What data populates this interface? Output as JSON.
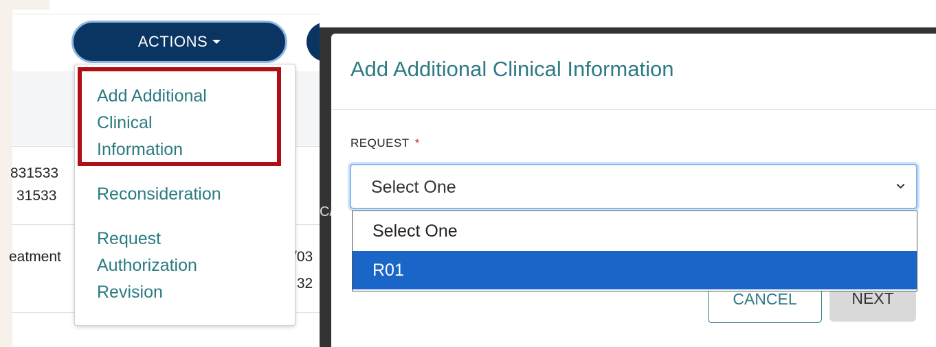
{
  "background_app": {
    "actions_button": {
      "label": "ACTIONS"
    },
    "actions_menu": {
      "items": [
        {
          "label_lines": [
            "Add Additional",
            "Clinical",
            "Information"
          ],
          "highlighted": true
        },
        {
          "label_lines": [
            "Reconsideration"
          ]
        },
        {
          "label_lines": [
            "Request",
            "Authorization",
            "Revision"
          ]
        }
      ]
    },
    "table_fragments": {
      "row1_line1": "831533",
      "row1_line2": "31533",
      "row2_line1": "eatment",
      "date_fragment": "/03",
      "time_fragment": ":32",
      "header_fragment": "C/"
    }
  },
  "modal": {
    "title": "Add Additional Clinical Information",
    "request_field": {
      "label": "REQUEST",
      "required_marker": "*",
      "selected_value": "Select One",
      "options": [
        "Select One",
        "R01"
      ],
      "highlighted_option": "R01"
    },
    "buttons": {
      "cancel": "CANCEL",
      "next": "NEXT"
    }
  },
  "colors": {
    "actions_button_bg": "#0a3562",
    "menu_text": "#2a7b80",
    "highlight_box": "#b00d14",
    "modal_title": "#2e7a85",
    "selected_option_bg": "#1a66c8",
    "required_star": "#cc2222"
  },
  "icons": {
    "actions_caret": "caret-down-icon",
    "select_chevron": "chevron-down-icon"
  }
}
